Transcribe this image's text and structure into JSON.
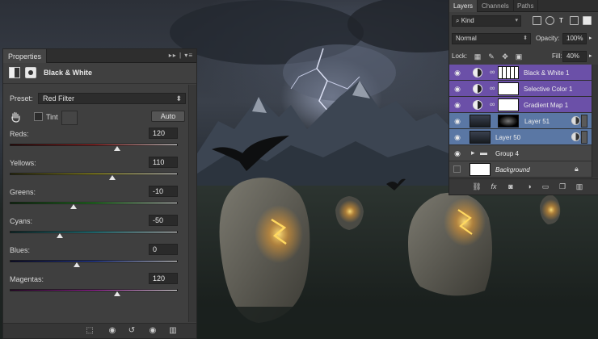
{
  "properties": {
    "tab_label": "Properties",
    "adjustment_title": "Black & White",
    "preset_label": "Preset:",
    "preset_value": "Red Filter",
    "tint_label": "Tint",
    "auto_label": "Auto",
    "sliders": [
      {
        "label": "Reds:",
        "value": "120",
        "fraction": 0.64,
        "gradient": [
          "#2a0000",
          "#b42020",
          "#ffffff"
        ]
      },
      {
        "label": "Yellows:",
        "value": "110",
        "fraction": 0.61,
        "gradient": [
          "#2a2a00",
          "#c8c020",
          "#ffffff"
        ]
      },
      {
        "label": "Greens:",
        "value": "-10",
        "fraction": 0.38,
        "gradient": [
          "#002a00",
          "#20b020",
          "#ffffff"
        ]
      },
      {
        "label": "Cyans:",
        "value": "-50",
        "fraction": 0.3,
        "gradient": [
          "#002a2a",
          "#20b4c0",
          "#ffffff"
        ]
      },
      {
        "label": "Blues:",
        "value": "0",
        "fraction": 0.4,
        "gradient": [
          "#00002a",
          "#2040c0",
          "#ffffff"
        ]
      },
      {
        "label": "Magentas:",
        "value": "120",
        "fraction": 0.64,
        "gradient": [
          "#2a002a",
          "#b020b0",
          "#ffffff"
        ]
      }
    ]
  },
  "layers_panel": {
    "tabs": [
      "Layers",
      "Channels",
      "Paths"
    ],
    "kind_label": "Kind",
    "blend_mode": "Normal",
    "opacity_label": "Opacity:",
    "opacity_value": "100%",
    "lock_label": "Lock:",
    "fill_label": "Fill:",
    "fill_value": "40%",
    "layers": [
      {
        "name": "Black & White 1",
        "kind": "adjustment",
        "style": "adj",
        "italic": false
      },
      {
        "name": "Selective Color 1",
        "kind": "adjustment",
        "style": "adj",
        "italic": false
      },
      {
        "name": "Gradient Map 1",
        "kind": "adjustment",
        "style": "adj",
        "italic": false
      },
      {
        "name": "Layer 51",
        "kind": "image",
        "style": "sel",
        "italic": false
      },
      {
        "name": "Layer 50",
        "kind": "image",
        "style": "sel",
        "italic": false
      },
      {
        "name": "Group 4",
        "kind": "group",
        "style": "norm",
        "italic": false
      },
      {
        "name": "Background",
        "kind": "background",
        "style": "norm",
        "italic": true
      }
    ]
  },
  "colors": {
    "adjustment_layer": "#6b50a8",
    "selected_layer": "#5a77a4",
    "rune_glow": "#ffb43c"
  }
}
